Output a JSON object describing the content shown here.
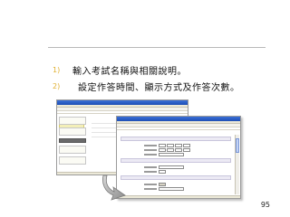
{
  "steps": [
    {
      "num": "1)",
      "text": "輸入考試名稱與相關說明。"
    },
    {
      "num": "2)",
      "text": "設定作答時間、顯示方式及作答次數。"
    }
  ],
  "page_number": "95",
  "icons": {
    "arrow": "curved-arrow-icon"
  },
  "colors": {
    "step_number": "#e0b030",
    "titlebar": "#1e4fb5"
  }
}
